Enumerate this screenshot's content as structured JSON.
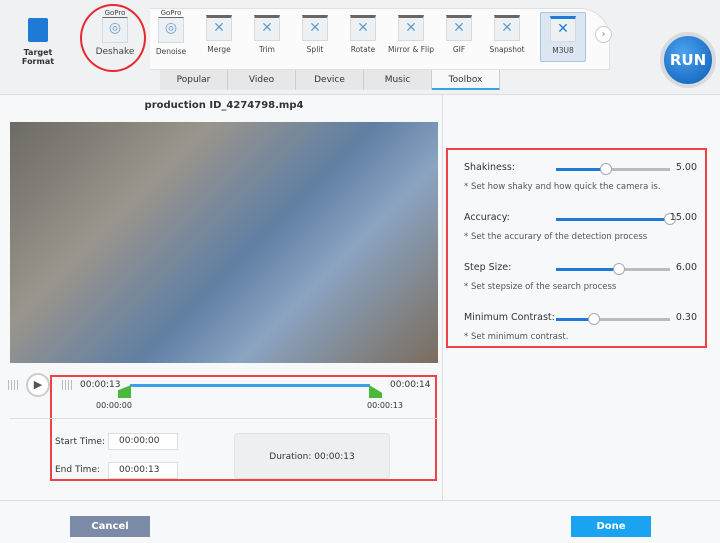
{
  "toolbar": {
    "target_format": "Target Format",
    "tools": [
      {
        "label": "Deshake",
        "brand": "GoPro",
        "icon": "gopro-deshake-icon"
      },
      {
        "label": "Denoise",
        "brand": "GoPro",
        "icon": "gopro-denoise-icon"
      },
      {
        "label": "Merge",
        "icon": "merge-icon"
      },
      {
        "label": "Trim",
        "icon": "tools-icon"
      },
      {
        "label": "Split",
        "icon": "tools-icon"
      },
      {
        "label": "Rotate",
        "icon": "tools-icon"
      },
      {
        "label": "Mirror & Flip",
        "icon": "tools-icon"
      },
      {
        "label": "GIF",
        "icon": "tools-icon"
      },
      {
        "label": "Snapshot",
        "icon": "tools-icon"
      },
      {
        "label": "M3U8",
        "icon": "tools-icon",
        "selected": true
      }
    ],
    "tabs": [
      "Popular",
      "Video",
      "Device",
      "Music",
      "Toolbox"
    ],
    "active_tab": "Toolbox",
    "run": "RUN"
  },
  "video": {
    "title": "production ID_4274798.mp4"
  },
  "timeline": {
    "current": "00:00:13",
    "total": "00:00:14",
    "start_marker": "00:00:00",
    "end_marker": "00:00:13",
    "start_label": "Start Time:",
    "start_value": "00:00:00",
    "end_label": "End Time:",
    "end_value": "00:00:13",
    "duration": "Duration:  00:00:13"
  },
  "settings": [
    {
      "label": "Shakiness:",
      "value": "5.00",
      "hint": "* Set how shaky and how quick the camera is.",
      "level": 0.44
    },
    {
      "label": "Accuracy:",
      "value": "15.00",
      "hint": "* Set the accurary of the detection process",
      "level": 1.0
    },
    {
      "label": "Step Size:",
      "value": "6.00",
      "hint": "* Set stepsize of the search process",
      "level": 0.55
    },
    {
      "label": "Minimum Contrast:",
      "value": "0.30",
      "hint": "* Set minimum contrast.",
      "level": 0.33
    }
  ],
  "footer": {
    "cancel": "Cancel",
    "done": "Done"
  },
  "colors": {
    "accent": "#1e7ad6",
    "highlight": "#f04048",
    "marker": "#4cb83a",
    "cancel": "#7b8aa6",
    "done": "#1aa3f0"
  }
}
